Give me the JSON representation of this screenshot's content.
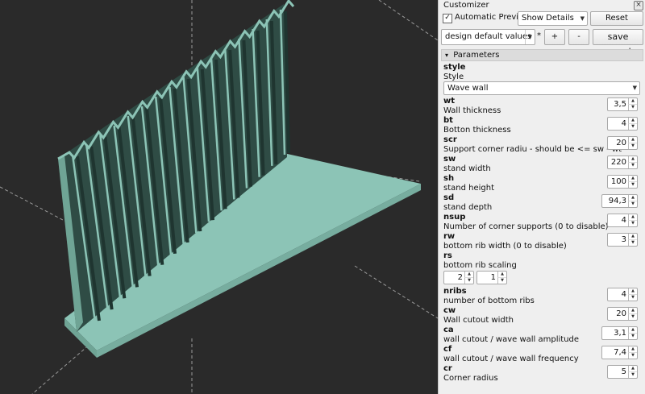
{
  "customizer": {
    "title": "Customizer",
    "close_icon": "close-icon",
    "auto_preview_checkbox": "✓",
    "auto_preview_label": "Automatic Preview",
    "details_select": "Show Details",
    "reset_label": "Reset",
    "preset_select": "design default values",
    "modified_marker": "*",
    "add_preset_label": "+",
    "remove_preset_label": "-",
    "save_preset_label": "save preset",
    "section_title": "Parameters",
    "section_arrow": "▾",
    "style": {
      "name": "style",
      "desc": "Style",
      "value": "Wave wall"
    },
    "params": [
      {
        "name": "wt",
        "desc": "Wall thickness",
        "value": "3,5"
      },
      {
        "name": "bt",
        "desc": "Botton thickness",
        "value": "4"
      },
      {
        "name": "scr",
        "desc": "Support corner radiu - should be <= sw - wt",
        "value": "20"
      },
      {
        "name": "sw",
        "desc": "stand width",
        "value": "220"
      },
      {
        "name": "sh",
        "desc": "stand height",
        "value": "100"
      },
      {
        "name": "sd",
        "desc": "stand depth",
        "value": "94,3"
      },
      {
        "name": "nsup",
        "desc": "Number of corner supports (0 to disable)",
        "value": "4"
      },
      {
        "name": "rw",
        "desc": "bottom rib width (0 to disable)",
        "value": "3"
      }
    ],
    "rs": {
      "name": "rs",
      "desc": "bottom rib scaling",
      "v1": "2",
      "v2": "1"
    },
    "params2": [
      {
        "name": "nribs",
        "desc": "number of bottom ribs",
        "value": "4"
      },
      {
        "name": "cw",
        "desc": "Wall cutout width",
        "value": "20"
      },
      {
        "name": "ca",
        "desc": "wall cutout / wave wall amplitude",
        "value": "3,1"
      },
      {
        "name": "cf",
        "desc": "wall cutout / wave wall frequency",
        "value": "7,4"
      },
      {
        "name": "cr",
        "desc": "Corner radius",
        "value": "5"
      }
    ]
  },
  "colors": {
    "viewport_bg": "#2a2a2a",
    "model_face": "#8cc4b6",
    "model_dark": "#2f4c45",
    "axis_lines": "#9a9a9a"
  }
}
